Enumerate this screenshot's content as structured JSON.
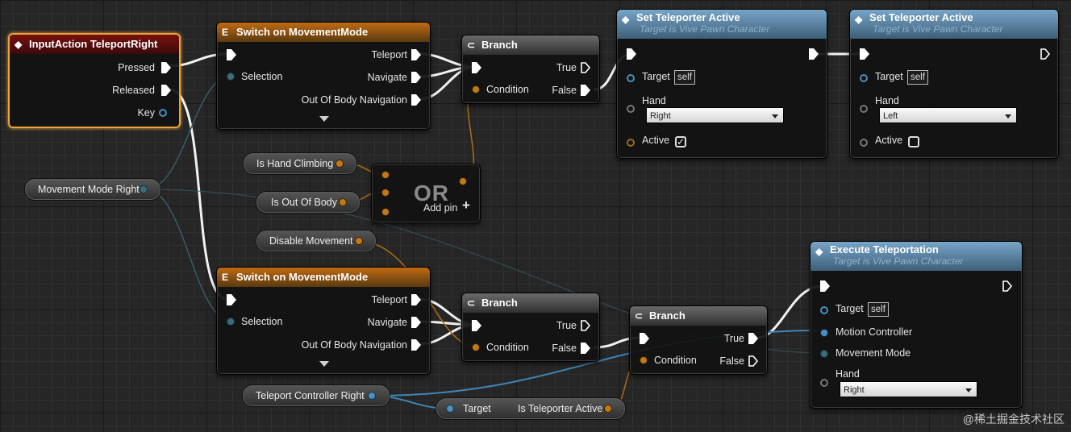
{
  "theme": {
    "exec_color": "#ffffff",
    "bool_color": "#c07a17",
    "object_color": "#4a8fc0",
    "enum_color": "#3b6e78",
    "selection_color": "#e8a33c"
  },
  "nodes": {
    "input_action": {
      "title": "InputAction TeleportRight",
      "icon": "diamond-icon",
      "pins": {
        "pressed": "Pressed",
        "released": "Released",
        "key": "Key"
      }
    },
    "switch_top": {
      "title": "Switch on MovementMode",
      "icon": "switch-icon",
      "pins": {
        "selection": "Selection",
        "teleport": "Teleport",
        "navigate": "Navigate",
        "out_of_body": "Out Of Body Navigation"
      }
    },
    "switch_bottom": {
      "title": "Switch on MovementMode",
      "icon": "switch-icon",
      "pins": {
        "selection": "Selection",
        "teleport": "Teleport",
        "navigate": "Navigate",
        "out_of_body": "Out Of Body Navigation"
      }
    },
    "branch_top": {
      "title": "Branch",
      "icon": "branch-icon",
      "pins": {
        "condition": "Condition",
        "true_pin": "True",
        "false_pin": "False"
      }
    },
    "branch_mid": {
      "title": "Branch",
      "icon": "branch-icon",
      "pins": {
        "condition": "Condition",
        "true_pin": "True",
        "false_pin": "False"
      }
    },
    "branch_right": {
      "title": "Branch",
      "icon": "branch-icon",
      "pins": {
        "condition": "Condition",
        "true_pin": "True",
        "false_pin": "False"
      }
    },
    "set_tp_1": {
      "title": "Set Teleporter Active",
      "subtitle": "Target is Vive Pawn Character",
      "icon": "function-icon",
      "pins": {
        "target": "Target",
        "self": "self",
        "hand": "Hand",
        "hand_value": "Right",
        "active": "Active",
        "active_checked": true
      }
    },
    "set_tp_2": {
      "title": "Set Teleporter Active",
      "subtitle": "Target is Vive Pawn Character",
      "icon": "function-icon",
      "pins": {
        "target": "Target",
        "self": "self",
        "hand": "Hand",
        "hand_value": "Left",
        "active": "Active",
        "active_checked": false
      }
    },
    "execute_tp": {
      "title": "Execute Teleportation",
      "subtitle": "Target is Vive Pawn Character",
      "icon": "function-icon",
      "pins": {
        "target": "Target",
        "self": "self",
        "motion_controller": "Motion Controller",
        "movement_mode": "Movement Mode",
        "hand": "Hand",
        "hand_value": "Right"
      }
    },
    "or_node": {
      "title": "OR",
      "add_pin": "Add pin"
    }
  },
  "variables": {
    "movement_mode_right": "Movement Mode Right",
    "is_hand_climbing": "Is Hand Climbing",
    "is_out_of_body": "Is Out Of Body",
    "disable_movement": "Disable Movement",
    "teleport_controller_right": "Teleport Controller Right",
    "is_tp_active_target": "Target",
    "is_tp_active_label": "Is Teleporter Active"
  },
  "watermark": "@稀土掘金技术社区"
}
